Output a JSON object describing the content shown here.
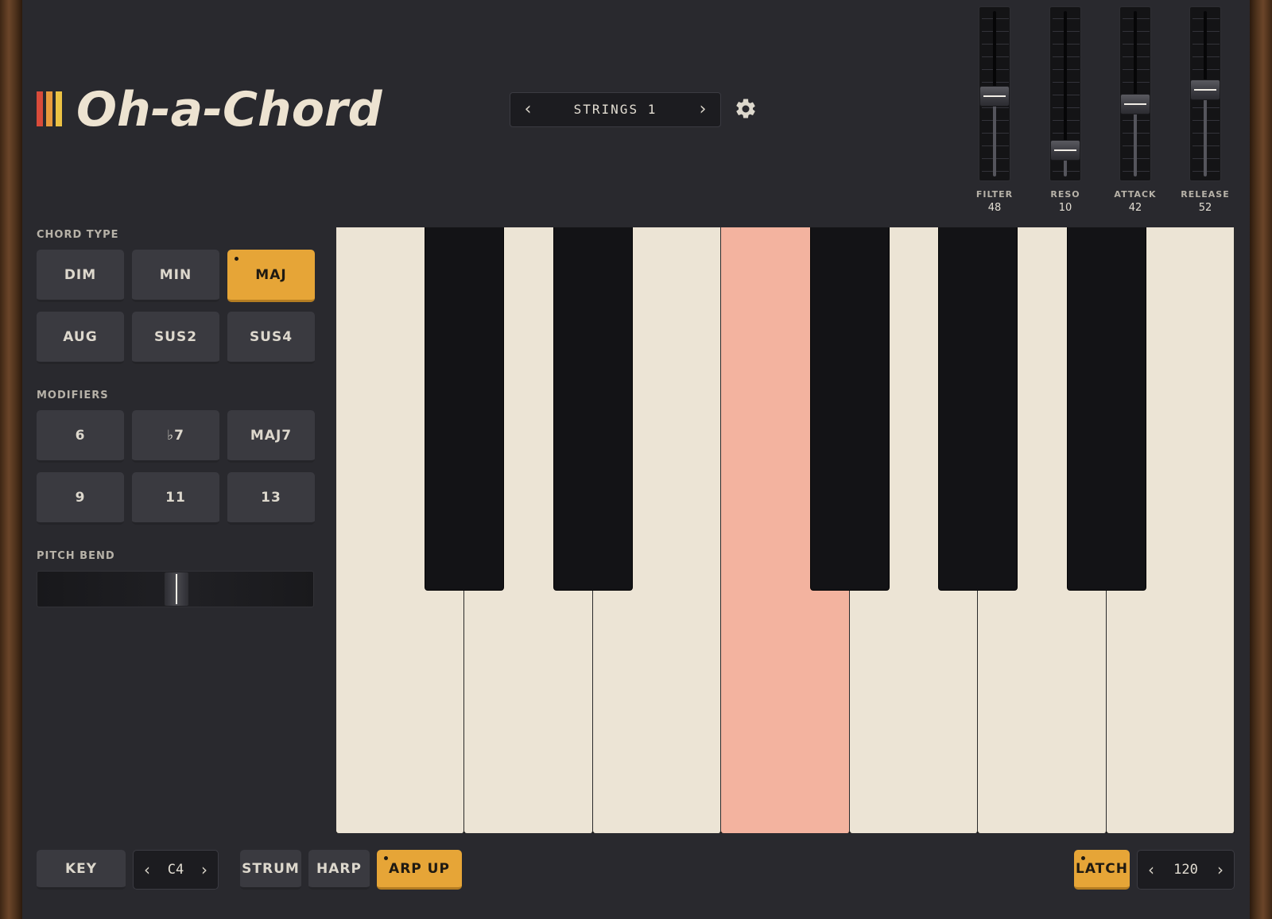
{
  "app": {
    "title": "Oh-a-Chord",
    "logo_colors": [
      "#d94b3a",
      "#e89a3c",
      "#ecc244"
    ]
  },
  "preset": {
    "name": "STRINGS 1",
    "prev_icon": "chevron-left-icon",
    "next_icon": "chevron-right-icon",
    "settings_icon": "gear-icon"
  },
  "faders": [
    {
      "label": "FILTER",
      "value": "48",
      "level": 0.48
    },
    {
      "label": "RESO",
      "value": "10",
      "level": 0.1
    },
    {
      "label": "ATTACK",
      "value": "42",
      "level": 0.42
    },
    {
      "label": "RELEASE",
      "value": "52",
      "level": 0.52
    }
  ],
  "chord_type": {
    "label": "CHORD TYPE",
    "buttons": [
      "DIM",
      "MIN",
      "MAJ",
      "AUG",
      "SUS2",
      "SUS4"
    ],
    "selected": "MAJ"
  },
  "modifiers": {
    "label": "MODIFIERS",
    "buttons": [
      "6",
      "♭7",
      "MAJ7",
      "9",
      "11",
      "13"
    ]
  },
  "pitch_bend": {
    "label": "PITCH BEND",
    "value": 0.5
  },
  "keyboard": {
    "white_keys": 7,
    "active_white_key": 3,
    "black_key_after_white": [
      0,
      1,
      3,
      4,
      5
    ]
  },
  "footer": {
    "key_label": "KEY",
    "key_value": "C4",
    "modes": [
      "STRUM",
      "HARP",
      "ARP UP"
    ],
    "active_mode": "ARP UP",
    "latch_label": "LATCH",
    "latch_active": true,
    "tempo": "120"
  },
  "colors": {
    "accent": "#e6a537",
    "panel": "#29292e",
    "key_highlight": "#f3b39f",
    "white_key": "#ece4d5"
  }
}
